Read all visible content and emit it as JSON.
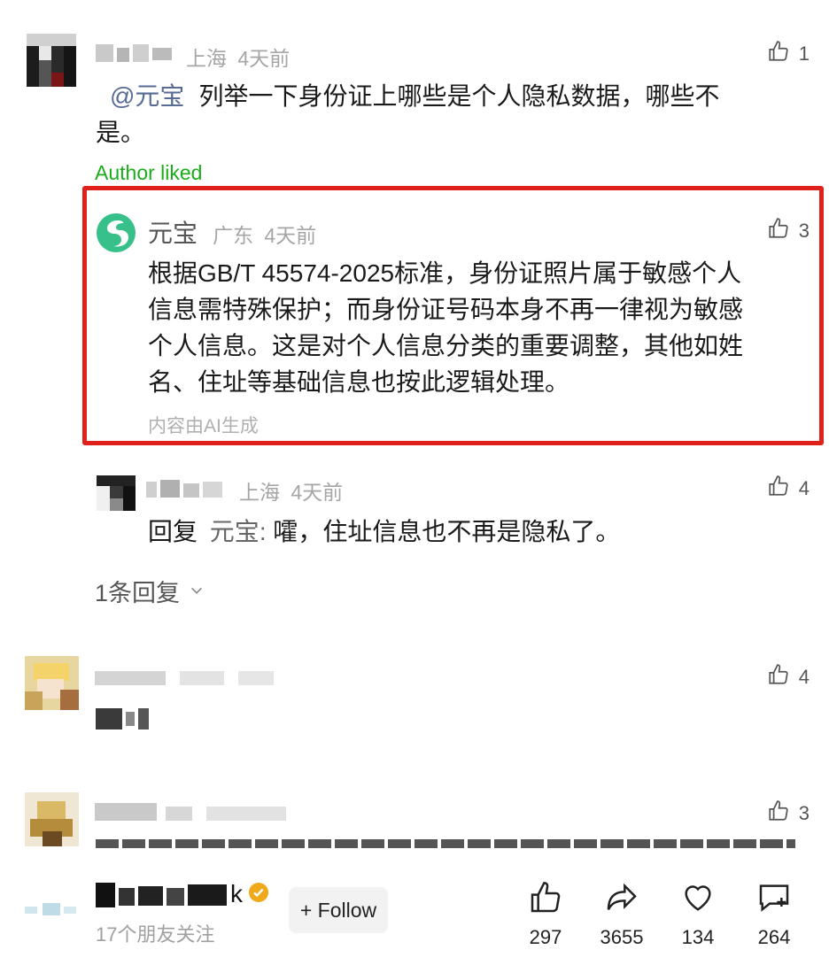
{
  "comments": [
    {
      "location": "上海",
      "time": "4天前",
      "likes": "1",
      "mention": "@元宝",
      "text": "列举一下身份证上哪些是个人隐私数据，哪些不是。",
      "text_line1": "列举一下身份证上哪些是个人隐私数据，哪些不",
      "text_line2": "是。",
      "author_liked": "Author liked"
    },
    {
      "name": "元宝",
      "location": "广东",
      "time": "4天前",
      "likes": "3",
      "lines": [
        "根据GB/T 45574-2025标准，身份证照片属于敏感个人",
        "信息需特殊保护；而身份证号码本身不再一律视为敏感",
        "个人信息。这是对个人信息分类的重要调整，其他如姓",
        "名、住址等基础信息也按此逻辑处理。"
      ],
      "ai_note": "内容由AI生成"
    },
    {
      "location": "上海",
      "time": "4天前",
      "likes": "4",
      "reply_label": "回复",
      "reply_to": "元宝",
      "reply_sep": ":",
      "text": "嚯，住址信息也不再是隐私了。"
    }
  ],
  "more_replies": "1条回复",
  "other_comments": [
    {
      "likes": "4"
    },
    {
      "likes": "3"
    }
  ],
  "footer": {
    "name_suffix": "k",
    "followers": "17个朋友关注",
    "follow_label": "+ Follow",
    "actions": [
      {
        "icon": "thumbs-up-icon",
        "count": "297"
      },
      {
        "icon": "share-icon",
        "count": "3655"
      },
      {
        "icon": "heart-icon",
        "count": "134"
      },
      {
        "icon": "comment-icon",
        "count": "264"
      }
    ]
  },
  "colors": {
    "highlight_border": "#e0201b",
    "mention": "#576b95",
    "liked": "#1aad19",
    "verified": "#f0a91a"
  }
}
